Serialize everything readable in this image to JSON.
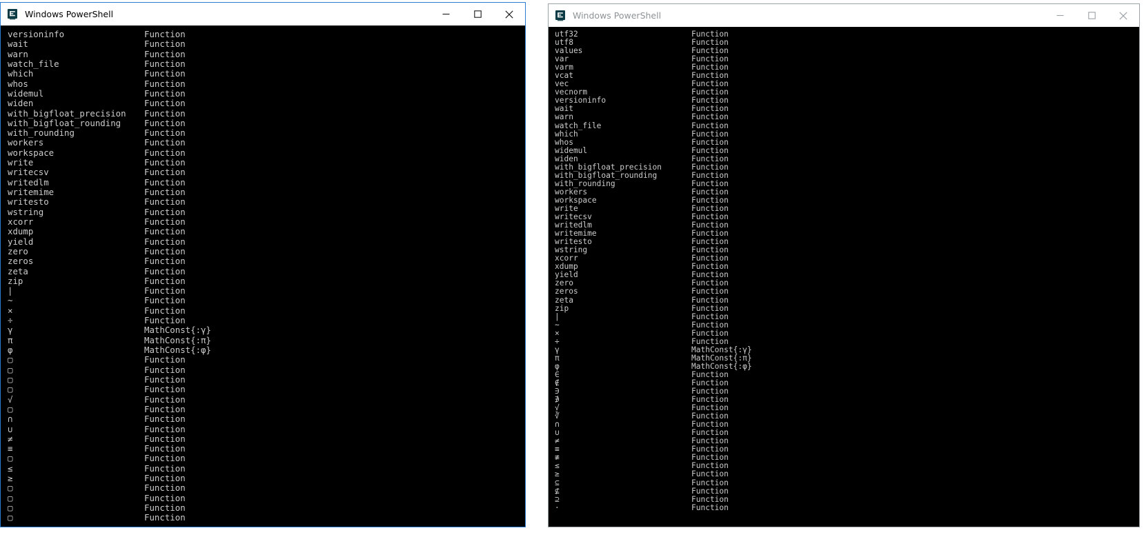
{
  "windows": [
    {
      "id": "left",
      "state": "active",
      "title": "Windows PowerShell",
      "icon": "powershell-icon",
      "caption_buttons": {
        "minimize": "—",
        "maximize": "□",
        "close": "✕"
      },
      "column_headers_visible": false,
      "rows": [
        {
          "name": "versioninfo",
          "type": "Function"
        },
        {
          "name": "wait",
          "type": "Function"
        },
        {
          "name": "warn",
          "type": "Function"
        },
        {
          "name": "watch_file",
          "type": "Function"
        },
        {
          "name": "which",
          "type": "Function"
        },
        {
          "name": "whos",
          "type": "Function"
        },
        {
          "name": "widemul",
          "type": "Function"
        },
        {
          "name": "widen",
          "type": "Function"
        },
        {
          "name": "with_bigfloat_precision",
          "type": "Function"
        },
        {
          "name": "with_bigfloat_rounding",
          "type": "Function"
        },
        {
          "name": "with_rounding",
          "type": "Function"
        },
        {
          "name": "workers",
          "type": "Function"
        },
        {
          "name": "workspace",
          "type": "Function"
        },
        {
          "name": "write",
          "type": "Function"
        },
        {
          "name": "writecsv",
          "type": "Function"
        },
        {
          "name": "writedlm",
          "type": "Function"
        },
        {
          "name": "writemime",
          "type": "Function"
        },
        {
          "name": "writesto",
          "type": "Function"
        },
        {
          "name": "wstring",
          "type": "Function"
        },
        {
          "name": "xcorr",
          "type": "Function"
        },
        {
          "name": "xdump",
          "type": "Function"
        },
        {
          "name": "yield",
          "type": "Function"
        },
        {
          "name": "zero",
          "type": "Function"
        },
        {
          "name": "zeros",
          "type": "Function"
        },
        {
          "name": "zeta",
          "type": "Function"
        },
        {
          "name": "zip",
          "type": "Function"
        },
        {
          "name": "|",
          "type": "Function"
        },
        {
          "name": "~",
          "type": "Function"
        },
        {
          "name": "×",
          "type": "Function"
        },
        {
          "name": "÷",
          "type": "Function"
        },
        {
          "name": "γ",
          "type": "MathConst{:γ}"
        },
        {
          "name": "π",
          "type": "MathConst{:π}"
        },
        {
          "name": "φ",
          "type": "MathConst{:φ}"
        },
        {
          "name": "▢",
          "type": "Function"
        },
        {
          "name": "▢",
          "type": "Function"
        },
        {
          "name": "▢",
          "type": "Function"
        },
        {
          "name": "▢",
          "type": "Function"
        },
        {
          "name": "√",
          "type": "Function"
        },
        {
          "name": "▢",
          "type": "Function"
        },
        {
          "name": "∩",
          "type": "Function"
        },
        {
          "name": "∪",
          "type": "Function"
        },
        {
          "name": "≠",
          "type": "Function"
        },
        {
          "name": "≡",
          "type": "Function"
        },
        {
          "name": "▢",
          "type": "Function"
        },
        {
          "name": "≤",
          "type": "Function"
        },
        {
          "name": "≥",
          "type": "Function"
        },
        {
          "name": "▢",
          "type": "Function"
        },
        {
          "name": "▢",
          "type": "Function"
        },
        {
          "name": "▢",
          "type": "Function"
        },
        {
          "name": "▢",
          "type": "Function"
        }
      ]
    },
    {
      "id": "right",
      "state": "inactive",
      "title": "Windows PowerShell",
      "icon": "powershell-icon",
      "caption_buttons": {
        "minimize": "—",
        "maximize": "□",
        "close": "✕"
      },
      "column_headers_visible": false,
      "rows": [
        {
          "name": "utf32",
          "type": "Function"
        },
        {
          "name": "utf8",
          "type": "Function"
        },
        {
          "name": "values",
          "type": "Function"
        },
        {
          "name": "var",
          "type": "Function"
        },
        {
          "name": "varm",
          "type": "Function"
        },
        {
          "name": "vcat",
          "type": "Function"
        },
        {
          "name": "vec",
          "type": "Function"
        },
        {
          "name": "vecnorm",
          "type": "Function"
        },
        {
          "name": "versioninfo",
          "type": "Function"
        },
        {
          "name": "wait",
          "type": "Function"
        },
        {
          "name": "warn",
          "type": "Function"
        },
        {
          "name": "watch_file",
          "type": "Function"
        },
        {
          "name": "which",
          "type": "Function"
        },
        {
          "name": "whos",
          "type": "Function"
        },
        {
          "name": "widemul",
          "type": "Function"
        },
        {
          "name": "widen",
          "type": "Function"
        },
        {
          "name": "with_bigfloat_precision",
          "type": "Function"
        },
        {
          "name": "with_bigfloat_rounding",
          "type": "Function"
        },
        {
          "name": "with_rounding",
          "type": "Function"
        },
        {
          "name": "workers",
          "type": "Function"
        },
        {
          "name": "workspace",
          "type": "Function"
        },
        {
          "name": "write",
          "type": "Function"
        },
        {
          "name": "writecsv",
          "type": "Function"
        },
        {
          "name": "writedlm",
          "type": "Function"
        },
        {
          "name": "writemime",
          "type": "Function"
        },
        {
          "name": "writesto",
          "type": "Function"
        },
        {
          "name": "wstring",
          "type": "Function"
        },
        {
          "name": "xcorr",
          "type": "Function"
        },
        {
          "name": "xdump",
          "type": "Function"
        },
        {
          "name": "yield",
          "type": "Function"
        },
        {
          "name": "zero",
          "type": "Function"
        },
        {
          "name": "zeros",
          "type": "Function"
        },
        {
          "name": "zeta",
          "type": "Function"
        },
        {
          "name": "zip",
          "type": "Function"
        },
        {
          "name": "|",
          "type": "Function"
        },
        {
          "name": "~",
          "type": "Function"
        },
        {
          "name": "×",
          "type": "Function"
        },
        {
          "name": "÷",
          "type": "Function"
        },
        {
          "name": "γ",
          "type": "MathConst{:γ}"
        },
        {
          "name": "π",
          "type": "MathConst{:π}"
        },
        {
          "name": "φ",
          "type": "MathConst{:φ}"
        },
        {
          "name": "∈",
          "type": "Function"
        },
        {
          "name": "∉",
          "type": "Function"
        },
        {
          "name": "∋",
          "type": "Function"
        },
        {
          "name": "∌",
          "type": "Function"
        },
        {
          "name": "√",
          "type": "Function"
        },
        {
          "name": "∛",
          "type": "Function"
        },
        {
          "name": "∩",
          "type": "Function"
        },
        {
          "name": "∪",
          "type": "Function"
        },
        {
          "name": "≠",
          "type": "Function"
        },
        {
          "name": "≡",
          "type": "Function"
        },
        {
          "name": "≢",
          "type": "Function"
        },
        {
          "name": "≤",
          "type": "Function"
        },
        {
          "name": "≥",
          "type": "Function"
        },
        {
          "name": "⊆",
          "type": "Function"
        },
        {
          "name": "⊈",
          "type": "Function"
        },
        {
          "name": "⊇",
          "type": "Function"
        },
        {
          "name": "·",
          "type": "Function"
        }
      ]
    }
  ],
  "colors": {
    "active_border": "#2b7cd3",
    "inactive_border": "#9aa3a8",
    "titlebar_bg": "#ffffff",
    "console_bg": "#000000",
    "console_fg": "#cccccc",
    "active_title_fg": "#000000",
    "inactive_title_fg": "#8d9396",
    "icon_bg": "#0d3b45",
    "desktop_bg": "#ffffff"
  }
}
